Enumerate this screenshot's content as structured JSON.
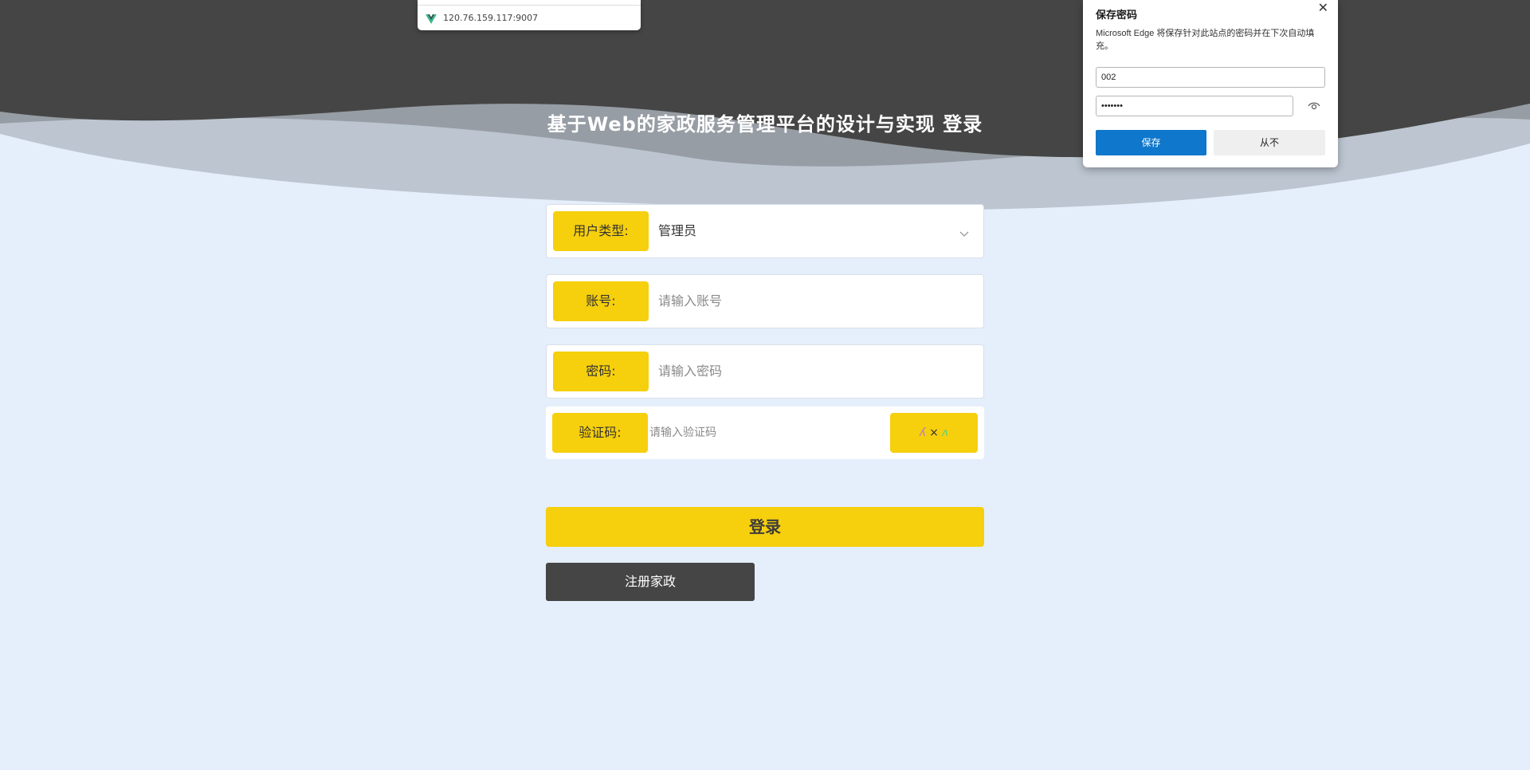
{
  "tab_tooltip": {
    "url": "120.76.159.117:9007",
    "icon": "vue-logo-icon"
  },
  "site": {
    "title": "基于Web的家政服务管理平台的设计与实现 登录"
  },
  "form": {
    "user_type": {
      "label": "用户类型:",
      "value": "管理员"
    },
    "account": {
      "label": "账号:",
      "placeholder": "请输入账号"
    },
    "password": {
      "label": "密码:",
      "placeholder": "请输入密码"
    },
    "captcha": {
      "label": "验证码:",
      "placeholder": "请输入验证码",
      "image_text_1": "ʎ",
      "image_text_2": "×",
      "image_text_3": "ʌ"
    },
    "login_label": "登录",
    "register_label": "注册家政"
  },
  "password_popup": {
    "title": "保存密码",
    "description": "Microsoft Edge 将保存针对此站点的密码并在下次自动填充。",
    "username": "002",
    "password_masked": "•••••••",
    "save_label": "保存",
    "never_label": "从不",
    "save_color": "#0f77cc"
  },
  "colors": {
    "accent": "#f6cf0d",
    "header_dark": "#454545",
    "background": "#e5effb"
  }
}
